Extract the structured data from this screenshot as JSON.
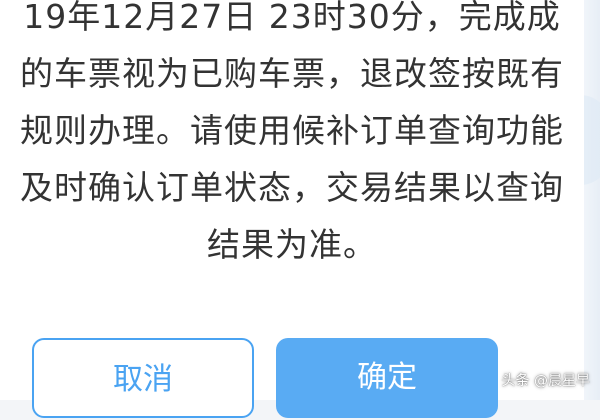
{
  "dialog": {
    "message_lines": [
      "19年12月27日 23时30分，完成成",
      "的车票视为已购车票，退改签按既有",
      "规则办理。请使用候补订单查询功能",
      "及时确认订单状态，交易结果以查询",
      "结果为准。"
    ],
    "cancel_label": "取消",
    "confirm_label": "确定"
  },
  "watermark": "头条 @晨星早",
  "colors": {
    "accent": "#4aa3f2",
    "confirm_bg": "#59abf3",
    "text": "#333333"
  }
}
